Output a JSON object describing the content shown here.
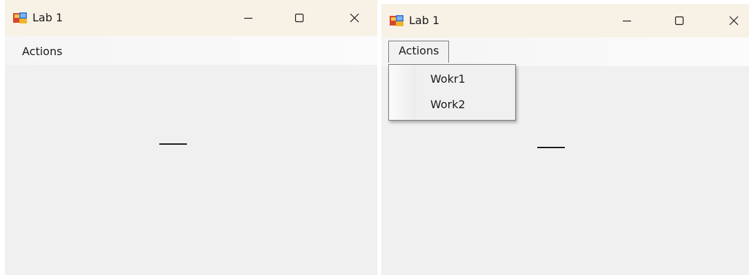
{
  "windows": [
    {
      "title": "Lab 1",
      "menu": {
        "actions_label": "Actions"
      },
      "controls": {
        "minimize": "minimize-icon",
        "maximize": "maximize-icon",
        "close": "close-icon"
      }
    },
    {
      "title": "Lab 1",
      "menu": {
        "actions_label": "Actions",
        "open": true,
        "items": [
          {
            "label": "Wokr1"
          },
          {
            "label": "Work2"
          }
        ]
      },
      "controls": {
        "minimize": "minimize-icon",
        "maximize": "maximize-icon",
        "close": "close-icon"
      }
    }
  ],
  "colors": {
    "titlebar": "#f8f1e6",
    "client": "#f0f0f0",
    "menu_border": "#7a7a7a",
    "text": "#1a1a1a"
  }
}
